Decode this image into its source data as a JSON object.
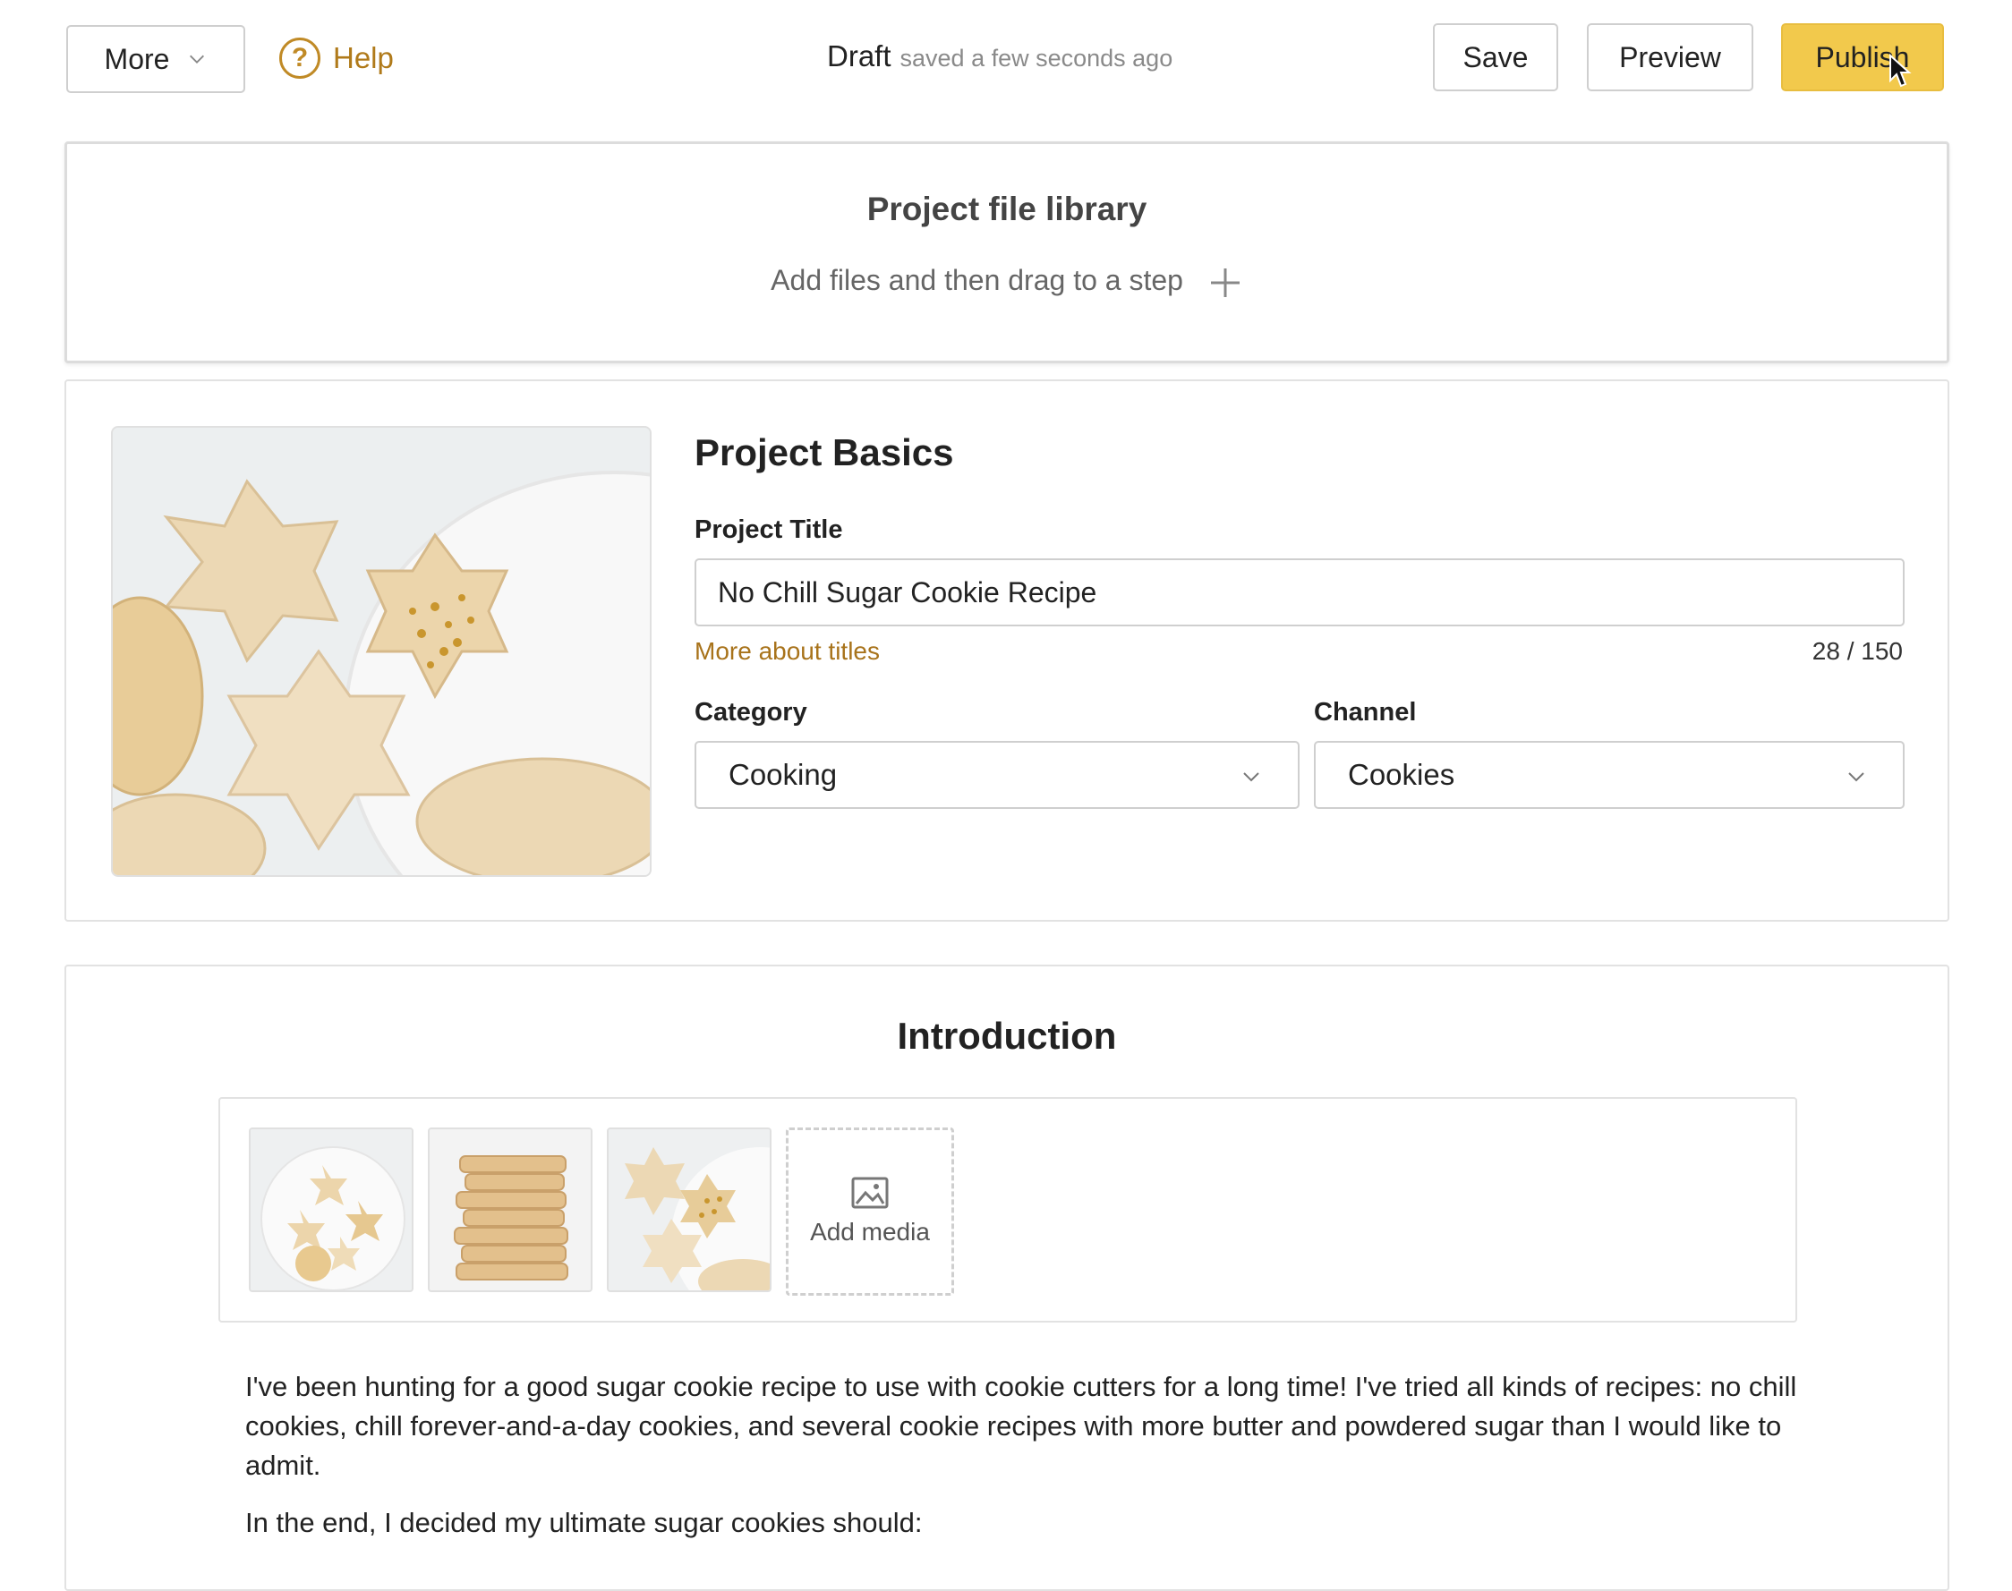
{
  "toolbar": {
    "more_label": "More",
    "help_label": "Help",
    "draft_label": "Draft",
    "saved_status": "saved a few seconds ago",
    "save_label": "Save",
    "preview_label": "Preview",
    "publish_label": "Publish"
  },
  "library": {
    "title": "Project file library",
    "subtitle": "Add files and then drag to a step"
  },
  "basics": {
    "title": "Project Basics",
    "title_label": "Project Title",
    "title_value": "No Chill Sugar Cookie Recipe",
    "more_titles_link": "More about titles",
    "char_count": "28 / 150",
    "category_label": "Category",
    "category_value": "Cooking",
    "channel_label": "Channel",
    "channel_value": "Cookies"
  },
  "intro": {
    "title": "Introduction",
    "add_media_label": "Add media",
    "paragraphs": [
      "I've been hunting for a good sugar cookie recipe to use with cookie cutters for a long time! I've tried all kinds of recipes: no chill cookies, chill forever-and-a-day cookies, and several cookie recipes with more butter and powdered sugar than I would like to admit.",
      "In the end, I decided my ultimate sugar cookies should:"
    ]
  },
  "colors": {
    "accent": "#f2c94c",
    "link": "#a8731b",
    "border": "#cfcfcf"
  },
  "icons": {
    "more_chevron": "chevron-down-icon",
    "help": "question-circle-icon",
    "library_add": "plus-icon",
    "select_chevron": "chevron-down-icon",
    "add_media": "image-icon",
    "cursor": "pointer-cursor-icon"
  }
}
